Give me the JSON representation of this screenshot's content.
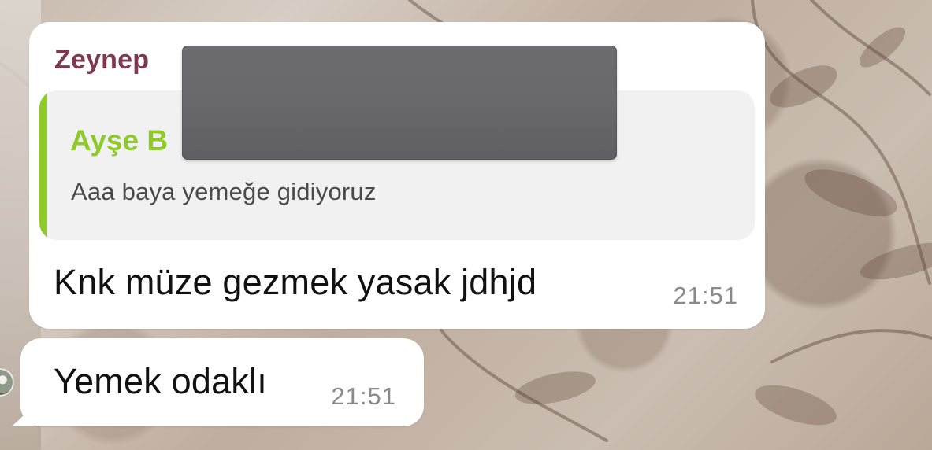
{
  "chat": {
    "message_1": {
      "sender_name": "Zeynep",
      "quoted_author": "Ayşe B",
      "quoted_text": "Aaa baya yemeğe gidiyoruz",
      "text": "Knk müze gezmek yasak jdhjd",
      "time": "21:51"
    },
    "message_2": {
      "text": "Yemek odaklı",
      "time": "21:51"
    }
  },
  "colors": {
    "sender_name": "#7e3952",
    "quote_accent": "#8fca2b",
    "bubble": "#ffffff",
    "timestamp": "#8a8a8a",
    "redaction": "#68686b"
  },
  "icons": {
    "avatar": "avatar-thumbnail"
  }
}
